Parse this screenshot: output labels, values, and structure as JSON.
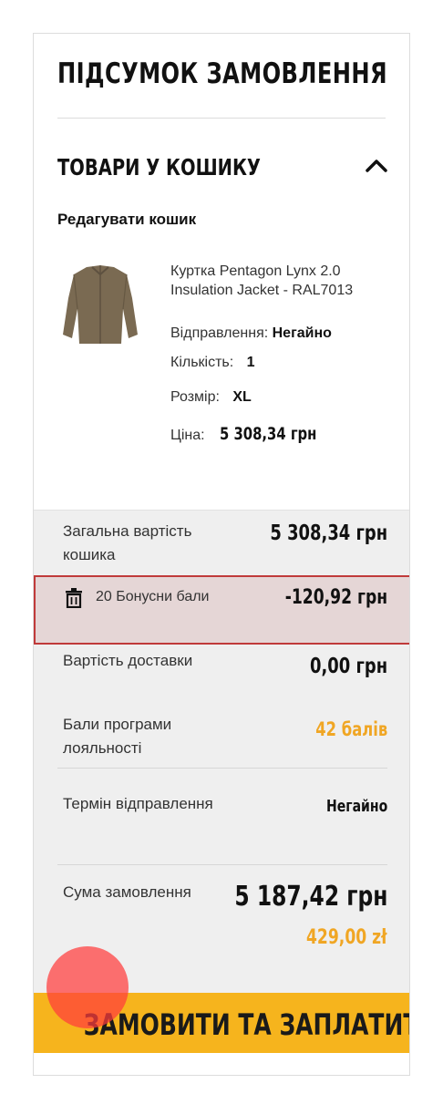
{
  "summary": {
    "title": "ПІДСУМОК ЗАМОВЛЕННЯ"
  },
  "cart": {
    "section_title": "ТОВАРИ У КОШИКУ",
    "edit_label": "Редагувати кошик"
  },
  "product": {
    "name": "Куртка Pentagon Lynx 2.0 Insulation Jacket - RAL7013",
    "shipping_label": "Відправлення:",
    "shipping_value": "Негайно",
    "qty_label": "Кількість:",
    "qty_value": "1",
    "size_label": "Розмір:",
    "size_value": "XL",
    "price_label": "Ціна:",
    "price_value": "5 308,34 грн"
  },
  "totals": {
    "cart_total_label": "Загальна вартість кошика",
    "cart_total_value": "5 308,34 грн",
    "bonus_label": "20 Бонусни бали",
    "bonus_value": "-120,92 грн",
    "delivery_label": "Вартість доставки",
    "delivery_value": "0,00 грн",
    "loyalty_label": "Бали програми лояльності",
    "loyalty_value": "42 балів",
    "ship_time_label": "Термін відправлення",
    "ship_time_value": "Негайно",
    "order_sum_label": "Сума замовлення",
    "order_sum_value": "5 187,42 грн",
    "order_sum_pln": "429,00 zł"
  },
  "cta": {
    "label": "ЗАМОВИТИ ТА ЗАПЛАТИТИ"
  },
  "colors": {
    "accent": "#f6b41d",
    "loyalty": "#f0a624",
    "bonus_bg": "#e5d6d6",
    "bonus_border": "#c03a3a"
  }
}
